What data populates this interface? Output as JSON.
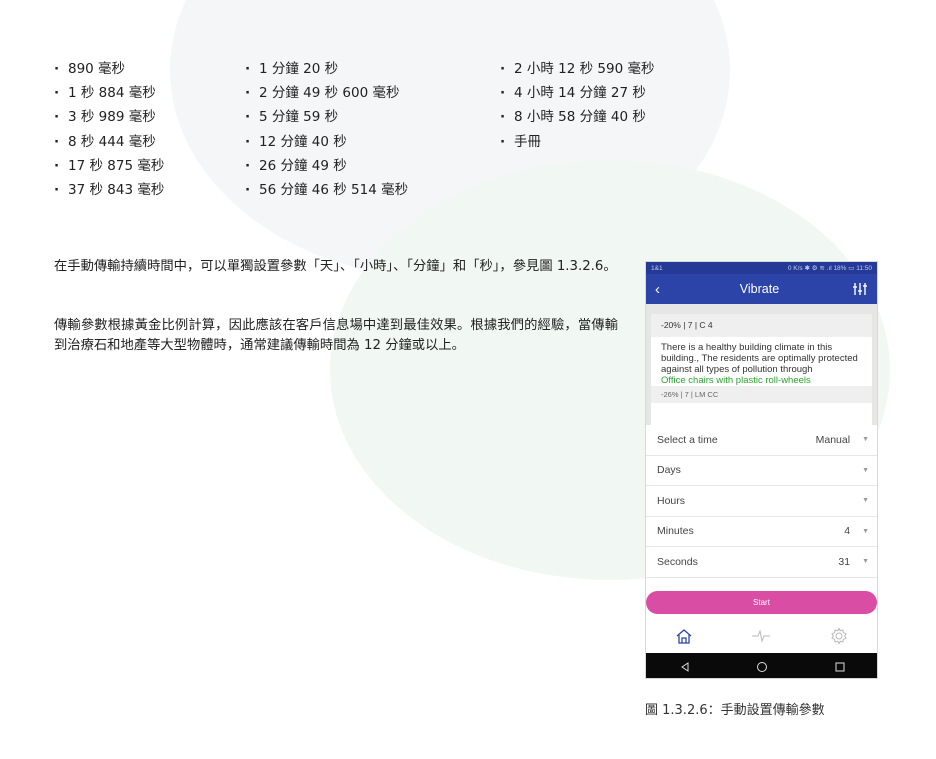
{
  "time_list": {
    "col1": [
      "890 毫秒",
      "1 秒 884 毫秒",
      "3 秒 989 毫秒",
      "8 秒 444 毫秒",
      "17 秒 875 毫秒",
      "37 秒 843 毫秒"
    ],
    "col2": [
      "1 分鐘 20 秒",
      "2 分鐘 49 秒 600 毫秒",
      "5 分鐘 59 秒",
      "12 分鐘 40 秒",
      "26 分鐘 49 秒",
      "56 分鐘 46 秒 514 毫秒"
    ],
    "col3": [
      "2 小時 12 秒 590 毫秒",
      "4 小時 14 分鐘 27 秒",
      "8 小時 58 分鐘 40 秒",
      "手冊"
    ]
  },
  "paragraphs": {
    "p1": "在手動傳輸持續時間中，可以單獨設置參數「天」、「小時」、「分鐘」和「秒」，參見圖 1.3.2.6。",
    "p2": "傳輸參數根據黃金比例計算，因此應該在客戶信息場中達到最佳效果。根據我們的經驗，當傳輸到治療石和地產等大型物體時，通常建議傳輸時間為 12 分鐘或以上。"
  },
  "phone": {
    "status_left": "1&1",
    "status_right": "0 K/s ✱ ⚙ ≋ .ıl 18% ▭ 11:50",
    "app_title": "Vibrate",
    "back_icon": "chevron-left-icon",
    "menu_icon": "equalizer-icon",
    "card_header": "-20% | 7 | C 4",
    "card_body": "There is a healthy building climate in this building., The residents are optimally protected against all types of pollution through",
    "card_highlight": "Office chairs with plastic roll-wheels",
    "card_next": "-26% | 7 | LM CC",
    "rows": [
      {
        "label": "Select a time",
        "value": "Manual"
      },
      {
        "label": "Days",
        "value": ""
      },
      {
        "label": "Hours",
        "value": ""
      },
      {
        "label": "Minutes",
        "value": "4"
      },
      {
        "label": "Seconds",
        "value": "31"
      }
    ],
    "start_label": "Start",
    "nav_icons": [
      "home-icon",
      "pulse-icon",
      "settings-icon"
    ],
    "sys_icons": [
      "back-icon",
      "home-circle-icon",
      "recents-icon"
    ],
    "accent_color": "#2c44a8",
    "button_color": "#d94da5"
  },
  "caption": "圖 1.3.2.6：手動設置傳輸參數"
}
